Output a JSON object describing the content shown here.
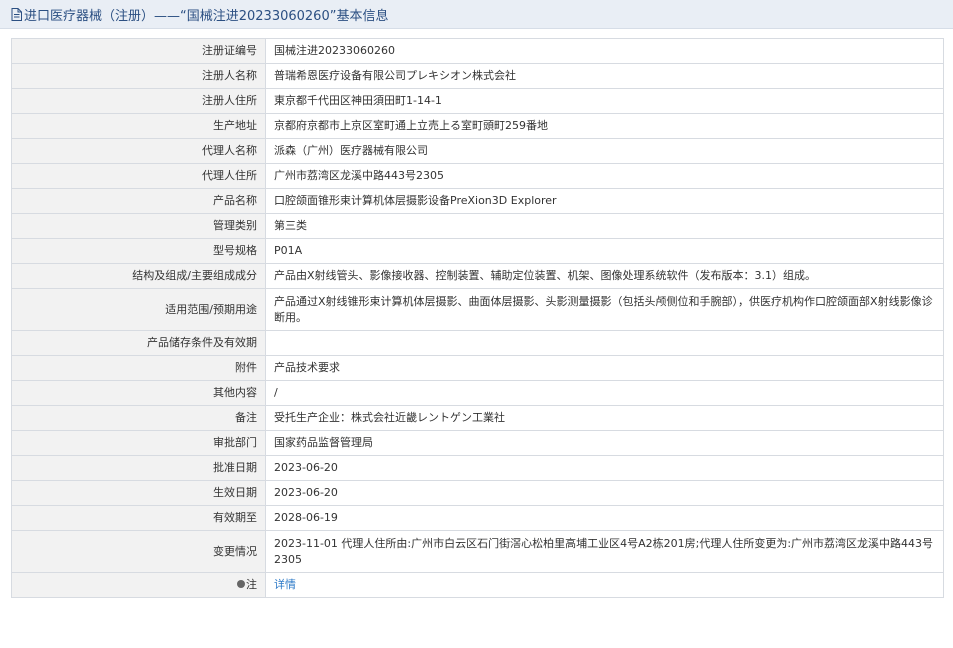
{
  "header": {
    "title": "进口医疗器械（注册）——“国械注进20233060260”基本信息"
  },
  "rows": [
    {
      "label": "注册证编号",
      "value": "国械注进20233060260"
    },
    {
      "label": "注册人名称",
      "value": "普瑞希恩医疗设备有限公司プレキシオン株式会社"
    },
    {
      "label": "注册人住所",
      "value": "東京都千代田区神田須田町1-14-1"
    },
    {
      "label": "生产地址",
      "value": "京都府京都市上京区室町通上立売上る室町頭町259番地"
    },
    {
      "label": "代理人名称",
      "value": "派森（广州）医疗器械有限公司"
    },
    {
      "label": "代理人住所",
      "value": "广州市荔湾区龙溪中路443号2305"
    },
    {
      "label": "产品名称",
      "value": "口腔颌面锥形束计算机体层摄影设备PreXion3D Explorer"
    },
    {
      "label": "管理类别",
      "value": "第三类"
    },
    {
      "label": "型号规格",
      "value": "P01A"
    },
    {
      "label": "结构及组成/主要组成成分",
      "value": "产品由X射线管头、影像接收器、控制装置、辅助定位装置、机架、图像处理系统软件（发布版本：3.1）组成。"
    },
    {
      "label": "适用范围/预期用途",
      "value": "产品通过X射线锥形束计算机体层摄影、曲面体层摄影、头影测量摄影（包括头颅侧位和手腕部），供医疗机构作口腔颌面部X射线影像诊断用。"
    },
    {
      "label": "产品储存条件及有效期",
      "value": ""
    },
    {
      "label": "附件",
      "value": "产品技术要求"
    },
    {
      "label": "其他内容",
      "value": "/"
    },
    {
      "label": "备注",
      "value": "受托生产企业：株式会社近畿レントゲン工業社"
    },
    {
      "label": "审批部门",
      "value": "国家药品监督管理局"
    },
    {
      "label": "批准日期",
      "value": "2023-06-20"
    },
    {
      "label": "生效日期",
      "value": "2023-06-20"
    },
    {
      "label": "有效期至",
      "value": "2028-06-19"
    },
    {
      "label": "变更情况",
      "value": "2023-11-01 代理人住所由:广州市白云区石门街滘心松柏里高埔工业区4号A2栋201房;代理人住所变更为:广州市荔湾区龙溪中路443号2305"
    }
  ],
  "note": {
    "label": "注",
    "link_text": "详情"
  },
  "colors": {
    "header_bg": "#e9eef5",
    "header_text": "#2b4f82",
    "label_bg": "#f2f2f2",
    "border": "#d7dbe1",
    "link": "#2a78c7"
  }
}
